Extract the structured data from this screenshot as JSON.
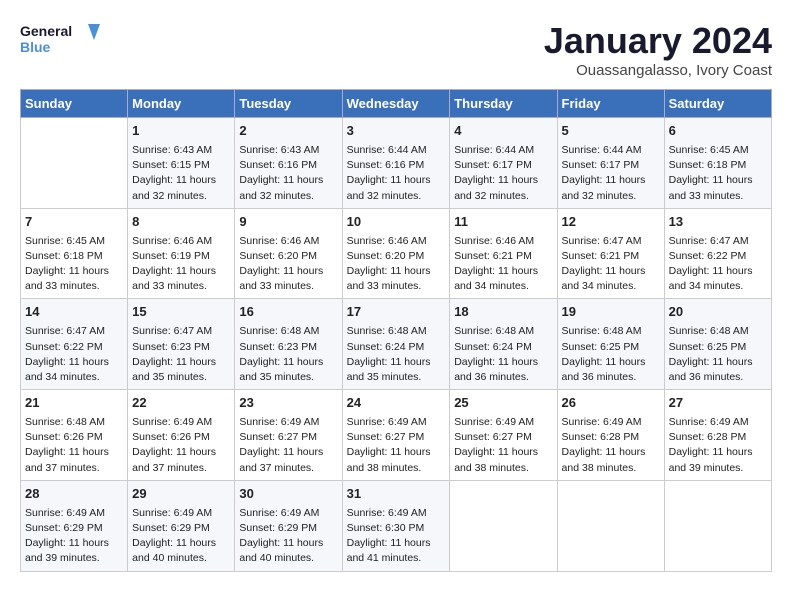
{
  "header": {
    "logo_line1": "General",
    "logo_line2": "Blue",
    "month": "January 2024",
    "location": "Ouassangalasso, Ivory Coast"
  },
  "days_of_week": [
    "Sunday",
    "Monday",
    "Tuesday",
    "Wednesday",
    "Thursday",
    "Friday",
    "Saturday"
  ],
  "weeks": [
    [
      {
        "day": "",
        "sunrise": "",
        "sunset": "",
        "daylight": ""
      },
      {
        "day": "1",
        "sunrise": "Sunrise: 6:43 AM",
        "sunset": "Sunset: 6:15 PM",
        "daylight": "Daylight: 11 hours and 32 minutes."
      },
      {
        "day": "2",
        "sunrise": "Sunrise: 6:43 AM",
        "sunset": "Sunset: 6:16 PM",
        "daylight": "Daylight: 11 hours and 32 minutes."
      },
      {
        "day": "3",
        "sunrise": "Sunrise: 6:44 AM",
        "sunset": "Sunset: 6:16 PM",
        "daylight": "Daylight: 11 hours and 32 minutes."
      },
      {
        "day": "4",
        "sunrise": "Sunrise: 6:44 AM",
        "sunset": "Sunset: 6:17 PM",
        "daylight": "Daylight: 11 hours and 32 minutes."
      },
      {
        "day": "5",
        "sunrise": "Sunrise: 6:44 AM",
        "sunset": "Sunset: 6:17 PM",
        "daylight": "Daylight: 11 hours and 32 minutes."
      },
      {
        "day": "6",
        "sunrise": "Sunrise: 6:45 AM",
        "sunset": "Sunset: 6:18 PM",
        "daylight": "Daylight: 11 hours and 33 minutes."
      }
    ],
    [
      {
        "day": "7",
        "sunrise": "Sunrise: 6:45 AM",
        "sunset": "Sunset: 6:18 PM",
        "daylight": "Daylight: 11 hours and 33 minutes."
      },
      {
        "day": "8",
        "sunrise": "Sunrise: 6:46 AM",
        "sunset": "Sunset: 6:19 PM",
        "daylight": "Daylight: 11 hours and 33 minutes."
      },
      {
        "day": "9",
        "sunrise": "Sunrise: 6:46 AM",
        "sunset": "Sunset: 6:20 PM",
        "daylight": "Daylight: 11 hours and 33 minutes."
      },
      {
        "day": "10",
        "sunrise": "Sunrise: 6:46 AM",
        "sunset": "Sunset: 6:20 PM",
        "daylight": "Daylight: 11 hours and 33 minutes."
      },
      {
        "day": "11",
        "sunrise": "Sunrise: 6:46 AM",
        "sunset": "Sunset: 6:21 PM",
        "daylight": "Daylight: 11 hours and 34 minutes."
      },
      {
        "day": "12",
        "sunrise": "Sunrise: 6:47 AM",
        "sunset": "Sunset: 6:21 PM",
        "daylight": "Daylight: 11 hours and 34 minutes."
      },
      {
        "day": "13",
        "sunrise": "Sunrise: 6:47 AM",
        "sunset": "Sunset: 6:22 PM",
        "daylight": "Daylight: 11 hours and 34 minutes."
      }
    ],
    [
      {
        "day": "14",
        "sunrise": "Sunrise: 6:47 AM",
        "sunset": "Sunset: 6:22 PM",
        "daylight": "Daylight: 11 hours and 34 minutes."
      },
      {
        "day": "15",
        "sunrise": "Sunrise: 6:47 AM",
        "sunset": "Sunset: 6:23 PM",
        "daylight": "Daylight: 11 hours and 35 minutes."
      },
      {
        "day": "16",
        "sunrise": "Sunrise: 6:48 AM",
        "sunset": "Sunset: 6:23 PM",
        "daylight": "Daylight: 11 hours and 35 minutes."
      },
      {
        "day": "17",
        "sunrise": "Sunrise: 6:48 AM",
        "sunset": "Sunset: 6:24 PM",
        "daylight": "Daylight: 11 hours and 35 minutes."
      },
      {
        "day": "18",
        "sunrise": "Sunrise: 6:48 AM",
        "sunset": "Sunset: 6:24 PM",
        "daylight": "Daylight: 11 hours and 36 minutes."
      },
      {
        "day": "19",
        "sunrise": "Sunrise: 6:48 AM",
        "sunset": "Sunset: 6:25 PM",
        "daylight": "Daylight: 11 hours and 36 minutes."
      },
      {
        "day": "20",
        "sunrise": "Sunrise: 6:48 AM",
        "sunset": "Sunset: 6:25 PM",
        "daylight": "Daylight: 11 hours and 36 minutes."
      }
    ],
    [
      {
        "day": "21",
        "sunrise": "Sunrise: 6:48 AM",
        "sunset": "Sunset: 6:26 PM",
        "daylight": "Daylight: 11 hours and 37 minutes."
      },
      {
        "day": "22",
        "sunrise": "Sunrise: 6:49 AM",
        "sunset": "Sunset: 6:26 PM",
        "daylight": "Daylight: 11 hours and 37 minutes."
      },
      {
        "day": "23",
        "sunrise": "Sunrise: 6:49 AM",
        "sunset": "Sunset: 6:27 PM",
        "daylight": "Daylight: 11 hours and 37 minutes."
      },
      {
        "day": "24",
        "sunrise": "Sunrise: 6:49 AM",
        "sunset": "Sunset: 6:27 PM",
        "daylight": "Daylight: 11 hours and 38 minutes."
      },
      {
        "day": "25",
        "sunrise": "Sunrise: 6:49 AM",
        "sunset": "Sunset: 6:27 PM",
        "daylight": "Daylight: 11 hours and 38 minutes."
      },
      {
        "day": "26",
        "sunrise": "Sunrise: 6:49 AM",
        "sunset": "Sunset: 6:28 PM",
        "daylight": "Daylight: 11 hours and 38 minutes."
      },
      {
        "day": "27",
        "sunrise": "Sunrise: 6:49 AM",
        "sunset": "Sunset: 6:28 PM",
        "daylight": "Daylight: 11 hours and 39 minutes."
      }
    ],
    [
      {
        "day": "28",
        "sunrise": "Sunrise: 6:49 AM",
        "sunset": "Sunset: 6:29 PM",
        "daylight": "Daylight: 11 hours and 39 minutes."
      },
      {
        "day": "29",
        "sunrise": "Sunrise: 6:49 AM",
        "sunset": "Sunset: 6:29 PM",
        "daylight": "Daylight: 11 hours and 40 minutes."
      },
      {
        "day": "30",
        "sunrise": "Sunrise: 6:49 AM",
        "sunset": "Sunset: 6:29 PM",
        "daylight": "Daylight: 11 hours and 40 minutes."
      },
      {
        "day": "31",
        "sunrise": "Sunrise: 6:49 AM",
        "sunset": "Sunset: 6:30 PM",
        "daylight": "Daylight: 11 hours and 41 minutes."
      },
      {
        "day": "",
        "sunrise": "",
        "sunset": "",
        "daylight": ""
      },
      {
        "day": "",
        "sunrise": "",
        "sunset": "",
        "daylight": ""
      },
      {
        "day": "",
        "sunrise": "",
        "sunset": "",
        "daylight": ""
      }
    ]
  ]
}
